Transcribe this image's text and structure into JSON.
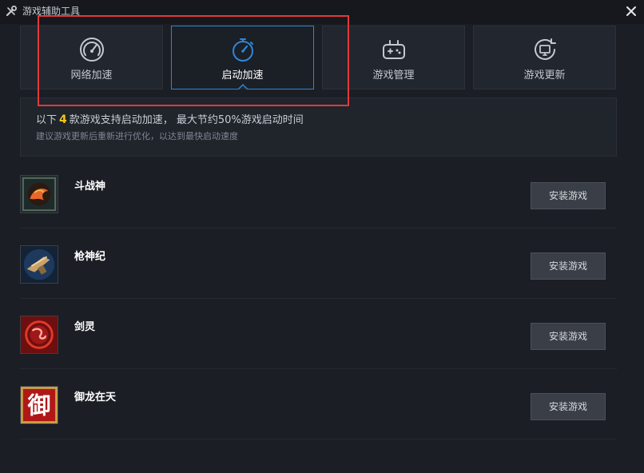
{
  "window": {
    "title": "游戏辅助工具",
    "close_icon": "close-icon"
  },
  "tabs": [
    {
      "label": "网络加速",
      "icon": "speedometer-icon",
      "active": false
    },
    {
      "label": "启动加速",
      "icon": "stopwatch-icon",
      "active": true
    },
    {
      "label": "游戏管理",
      "icon": "gamepad-icon",
      "active": false
    },
    {
      "label": "游戏更新",
      "icon": "monitor-update-icon",
      "active": false
    }
  ],
  "info": {
    "prefix": "以下",
    "count": "4",
    "suffix": "款游戏支持启动加速， 最大节约50%游戏启动时间",
    "hint": "建议游戏更新后重新进行优化，以达到最快启动速度"
  },
  "games": [
    {
      "name": "斗战神",
      "button": "安装游戏"
    },
    {
      "name": "枪神纪",
      "button": "安装游戏"
    },
    {
      "name": "剑灵",
      "button": "安装游戏"
    },
    {
      "name": "御龙在天",
      "button": "安装游戏",
      "icon_glyph": "御"
    }
  ],
  "colors": {
    "accent": "#2f86d8",
    "highlight_box": "#e03a3a",
    "count_yellow": "#f5c518",
    "background": "#1b1e24"
  }
}
